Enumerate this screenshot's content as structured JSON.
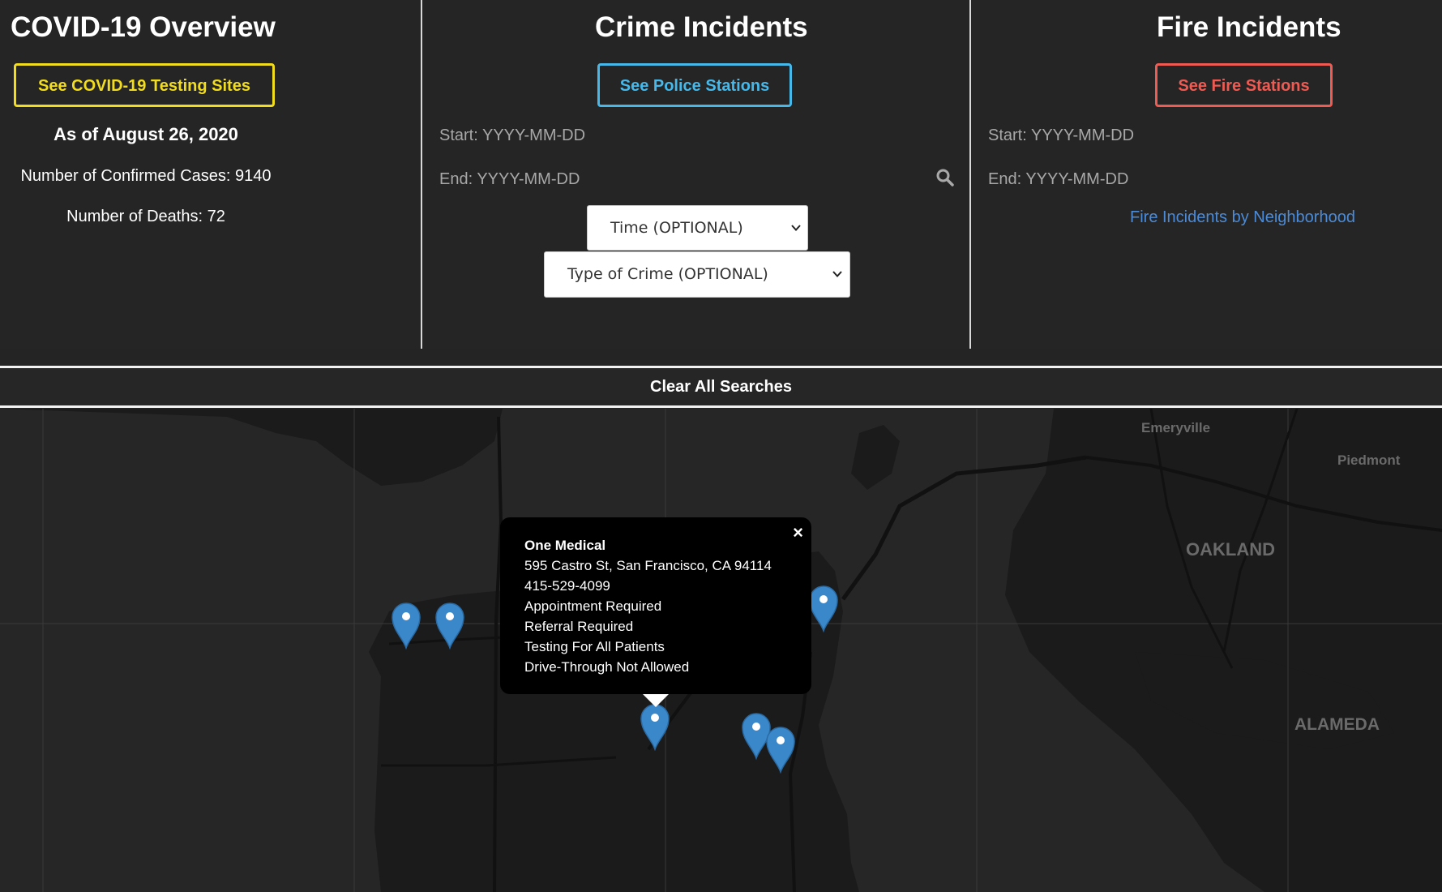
{
  "covid": {
    "title": "COVID-19 Overview",
    "button_label": "See COVID-19 Testing Sites",
    "as_of": "As of August 26, 2020",
    "confirmed_cases": "Number of Confirmed Cases: 9140",
    "deaths": "Number of Deaths: 72",
    "accent_color": "#f2dc1e"
  },
  "crime": {
    "title": "Crime Incidents",
    "button_label": "See Police Stations",
    "start_placeholder": "Start: YYYY-MM-DD",
    "end_placeholder": "End: YYYY-MM-DD",
    "search_icon": "search-icon",
    "time_select": "Time (OPTIONAL)",
    "type_select": "Type of Crime (OPTIONAL)",
    "accent_color": "#46b8ea"
  },
  "fire": {
    "title": "Fire Incidents",
    "button_label": "See Fire Stations",
    "start_placeholder": "Start: YYYY-MM-DD",
    "end_placeholder": "End: YYYY-MM-DD",
    "neighborhood_link": "Fire Incidents by Neighborhood",
    "accent_color": "#ef5b52"
  },
  "clear_button": "Clear All Searches",
  "map": {
    "labels": {
      "emeryville": "Emeryville",
      "piedmont": "Piedmont",
      "oakland": "OAKLAND",
      "alameda": "ALAMEDA"
    },
    "marker_color": "#3a87c9",
    "popup": {
      "name": "One Medical",
      "address": "595 Castro St, San Francisco, CA 94114",
      "phone": "415-529-4099",
      "appointment": "Appointment Required",
      "referral": "Referral Required",
      "testing": "Testing For All Patients",
      "drive_through": "Drive-Through Not Allowed",
      "close_icon": "×"
    }
  }
}
